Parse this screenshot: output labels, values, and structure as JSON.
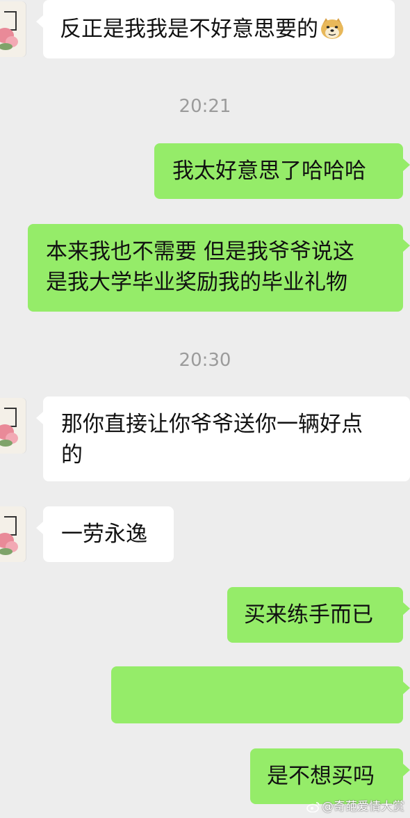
{
  "messages": [
    {
      "side": "in",
      "text": "反正是我我是不好意思要的",
      "emoji": "doge-emoji"
    },
    {
      "side": "out",
      "text": "我太好意思了哈哈哈"
    },
    {
      "side": "out",
      "line1": "本来我也不需要 但是我爷爷说这",
      "line2": "是我大学毕业奖励我的毕业礼物"
    },
    {
      "side": "in",
      "line1": "那你直接让你爷爷送你一辆好点",
      "line2": "的"
    },
    {
      "side": "in",
      "text": "一劳永逸"
    },
    {
      "side": "out",
      "text": "买来练手而已"
    },
    {
      "side": "out",
      "text": ""
    },
    {
      "side": "out",
      "text": "是不想买吗"
    }
  ],
  "timestamps": [
    "20:21",
    "20:30"
  ],
  "watermark": {
    "text": "@奇葩爱情大赏",
    "icon": "weibo-icon"
  },
  "colors": {
    "background": "#ededed",
    "incoming_bubble": "#ffffff",
    "outgoing_bubble": "#95ec69"
  }
}
